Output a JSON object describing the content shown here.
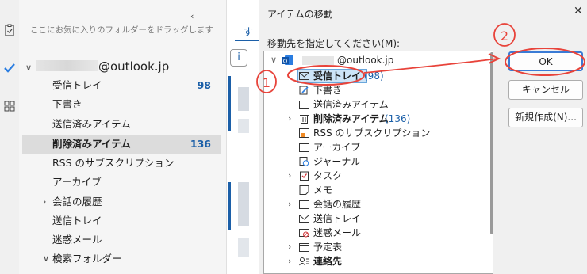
{
  "folder_pane": {
    "favorites_hint": "ここにお気に入りのフォルダーをドラッグします",
    "account": "@outlook.jp",
    "items": [
      {
        "label": "受信トレイ",
        "count": "98"
      },
      {
        "label": "下書き",
        "count": ""
      },
      {
        "label": "送信済みアイテム",
        "count": ""
      },
      {
        "label": "削除済みアイテム",
        "count": "136"
      },
      {
        "label": "RSS のサブスクリプション",
        "count": ""
      },
      {
        "label": "アーカイブ",
        "count": ""
      },
      {
        "label": "会話の履歴",
        "count": ""
      },
      {
        "label": "送信トレイ",
        "count": ""
      },
      {
        "label": "迷惑メール",
        "count": ""
      },
      {
        "label": "検索フォルダー",
        "count": ""
      }
    ]
  },
  "list_strip": {
    "tab_char": "す"
  },
  "dialog": {
    "title": "アイテムの移動",
    "destination_label": "移動先を指定してください(M):",
    "account": "@outlook.jp",
    "tree": [
      {
        "label": "受信トレイ",
        "count": "(98)"
      },
      {
        "label": "下書き",
        "count": ""
      },
      {
        "label": "送信済みアイテム",
        "count": ""
      },
      {
        "label": "削除済みアイテム",
        "count": "(136)"
      },
      {
        "label": "RSS のサブスクリプション",
        "count": ""
      },
      {
        "label": "アーカイブ",
        "count": ""
      },
      {
        "label": "ジャーナル",
        "count": ""
      },
      {
        "label": "タスク",
        "count": ""
      },
      {
        "label": "メモ",
        "count": ""
      },
      {
        "label": "会話の履歴",
        "count": ""
      },
      {
        "label": "送信トレイ",
        "count": ""
      },
      {
        "label": "迷惑メール",
        "count": ""
      },
      {
        "label": "予定表",
        "count": ""
      },
      {
        "label": "連絡先",
        "count": ""
      }
    ],
    "buttons": {
      "ok": "OK",
      "cancel": "キャンセル",
      "new": "新規作成(N)..."
    }
  },
  "annotations": {
    "step1": "1",
    "step2": "2"
  },
  "colors": {
    "accent": "#1b5fa8",
    "annotation": "#e8433a"
  }
}
